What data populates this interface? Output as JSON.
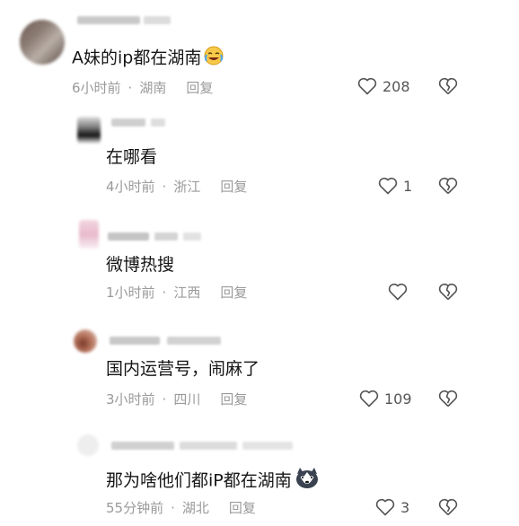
{
  "comments": [
    {
      "text": "A妹的ip都在湖南",
      "time": "6小时前",
      "location": "湖南",
      "reply": "回复",
      "likes": "208",
      "emoji": "laugh-cry-emoji"
    },
    {
      "text": "在哪看",
      "time": "4小时前",
      "location": "浙江",
      "reply": "回复",
      "likes": "1"
    },
    {
      "text": "微博热搜",
      "time": "1小时前",
      "location": "江西",
      "reply": "回复",
      "likes": ""
    },
    {
      "text": "国内运营号，闹麻了",
      "time": "3小时前",
      "location": "四川",
      "reply": "回复",
      "likes": "109"
    },
    {
      "text": "那为啥他们都iP都在湖南",
      "time": "55分钟前",
      "location": "湖北",
      "reply": "回复",
      "likes": "3",
      "emoji": "husky-dog-emoji"
    }
  ],
  "separator": "·"
}
